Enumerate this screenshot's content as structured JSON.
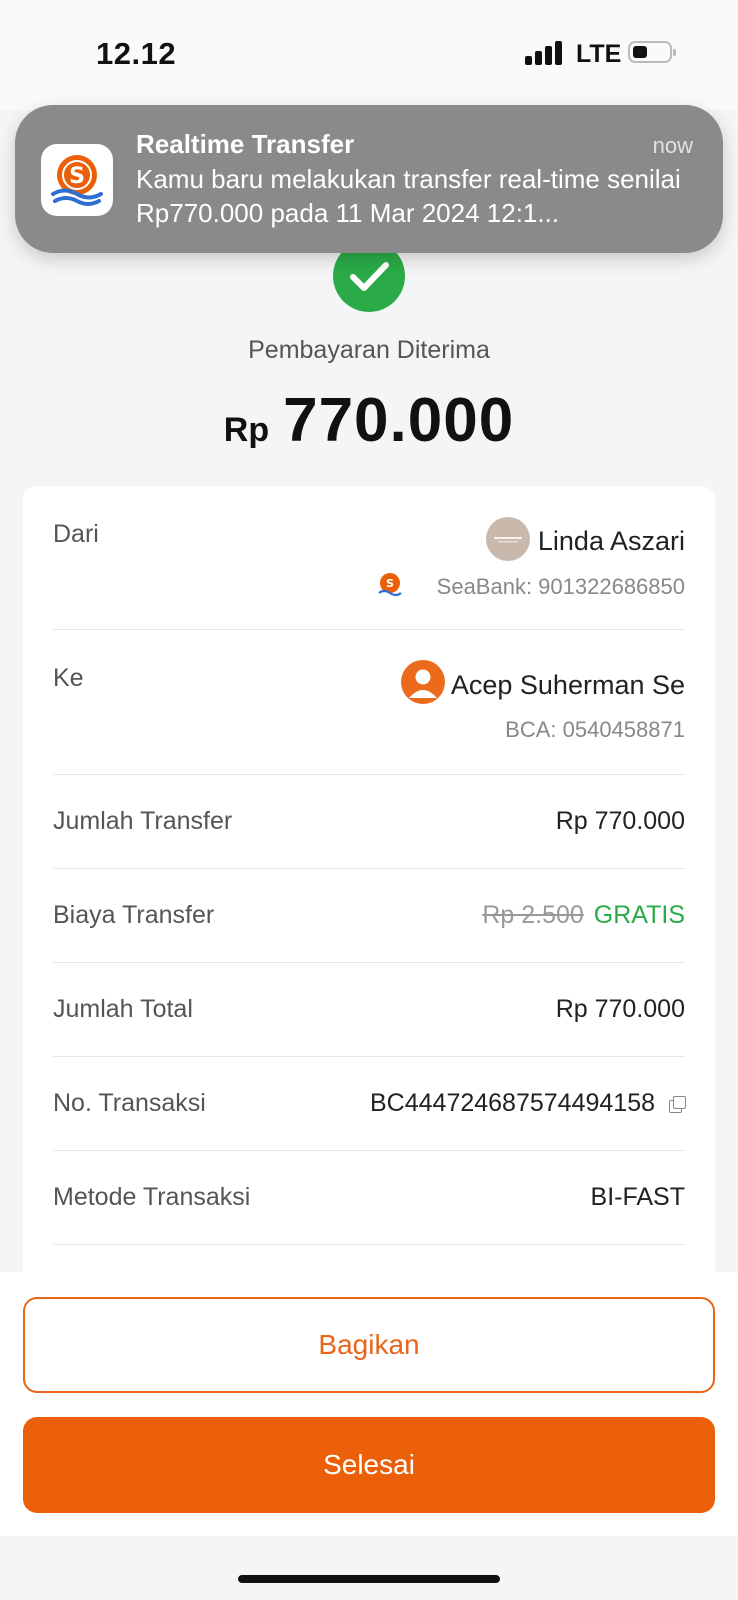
{
  "status_bar": {
    "time": "12.12",
    "network": "LTE"
  },
  "notification": {
    "app_icon": "seabank-logo-icon",
    "title": "Realtime Transfer",
    "time": "now",
    "body": "Kamu baru melakukan transfer real-time senilai Rp770.000 pada 11 Mar 2024 12:1..."
  },
  "result": {
    "status_icon": "check-circle-icon",
    "status_text": "Pembayaran Diterima",
    "currency": "Rp",
    "amount": "770.000"
  },
  "details": {
    "from": {
      "label": "Dari",
      "name": "Linda Aszari",
      "account": "SeaBank: 901322686850"
    },
    "to": {
      "label": "Ke",
      "name": "Acep Suherman Se",
      "account": "BCA: 0540458871"
    },
    "transfer_amount": {
      "label": "Jumlah Transfer",
      "value": "Rp 770.000"
    },
    "transfer_fee": {
      "label": "Biaya Transfer",
      "original": "Rp 2.500",
      "value": "GRATIS"
    },
    "total": {
      "label": "Jumlah Total",
      "value": "Rp 770.000"
    },
    "transaction_no": {
      "label": "No. Transaksi",
      "value": "BC444724687574494158"
    },
    "method": {
      "label": "Metode Transaksi",
      "value": "BI-FAST"
    }
  },
  "actions": {
    "share_label": "Bagikan",
    "done_label": "Selesai"
  },
  "colors": {
    "accent": "#ea5f07",
    "success": "#2bab47",
    "notification_bg": "#8a8a8a"
  }
}
